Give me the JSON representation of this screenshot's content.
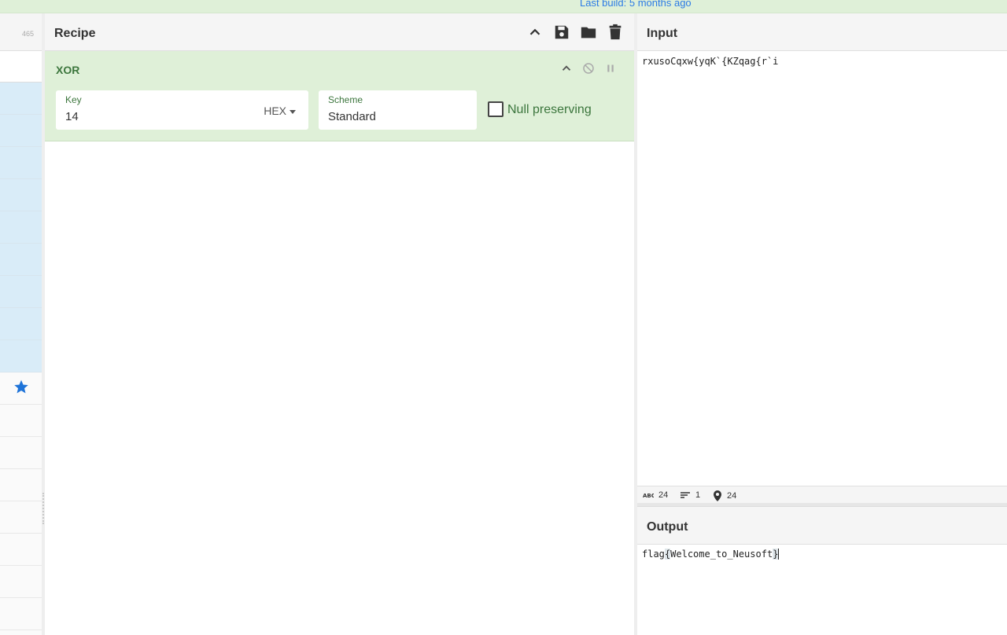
{
  "banner": {
    "text": "Last build: 5 months ago"
  },
  "operations": {
    "count": "465",
    "favourite_icon": "star-icon"
  },
  "recipe": {
    "title": "Recipe",
    "operation": {
      "name": "XOR",
      "key_label": "Key",
      "key_value": "14",
      "key_format": "HEX",
      "scheme_label": "Scheme",
      "scheme_value": "Standard",
      "null_preserving_label": "Null preserving",
      "null_preserving_checked": false
    }
  },
  "input": {
    "title": "Input",
    "text": "rxusoCqxw{yqK`{KZqag{r`i",
    "stats": {
      "length": "24",
      "lines": "1",
      "position": "24"
    }
  },
  "output": {
    "title": "Output",
    "text_start": "flag",
    "text_brace_open": "{",
    "text_middle": "Welcome_to_Neusoft",
    "text_brace_close": "}"
  },
  "colors": {
    "accent_green": "#3c763d",
    "card_bg": "#dff0d8",
    "link_blue": "#2c7be5",
    "favourite_bg": "#d9ecf8"
  }
}
